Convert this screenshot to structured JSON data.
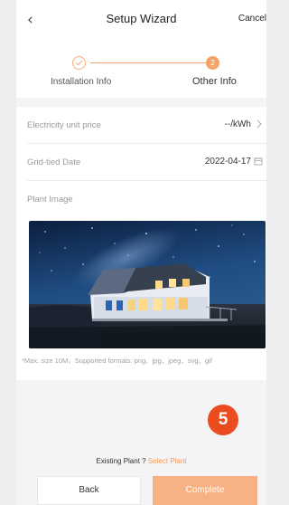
{
  "header": {
    "title": "Setup Wizard",
    "cancel_label": "Cancel",
    "back_icon": "chevron-left-icon"
  },
  "steps": [
    {
      "label": "Installation Info",
      "state": "done",
      "icon": "check-icon"
    },
    {
      "label": "Other Info",
      "state": "active",
      "number": "2"
    }
  ],
  "form": {
    "electricity_price": {
      "label": "Electricity unit price",
      "value": "--/kWh",
      "icon": "chevron-right-icon"
    },
    "grid_date": {
      "label": "Grid-tied Date",
      "value": "2022-04-17",
      "icon": "calendar-icon"
    },
    "plant_image": {
      "label": "Plant Image",
      "hint": "*Max. size 10M，Supported formats: png、jpg、jpeg、svg、gif"
    }
  },
  "badge": "5",
  "footer": {
    "existing_text": "Existing Plant ?",
    "select_link": "Select Plant",
    "back_label": "Back",
    "complete_label": "Complete"
  },
  "colors": {
    "accent": "#f5a469",
    "accent_light": "#f8b184",
    "badge": "#ea4c1d"
  }
}
